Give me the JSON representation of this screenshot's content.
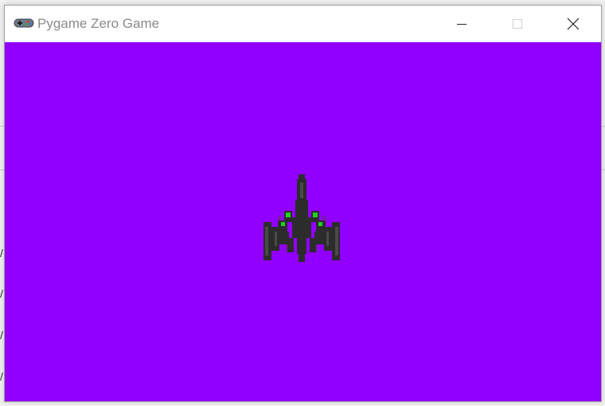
{
  "window": {
    "title": "Pygame Zero Game",
    "app_icon": "gamepad-icon",
    "controls": [
      "minimize-icon",
      "maximize-icon",
      "close-icon"
    ]
  },
  "game": {
    "background_color": "#9100ff",
    "sprite": "spaceship-icon",
    "sprite_colors": {
      "hull": "#2c2c2c",
      "highlight": "#4a4a4a",
      "engine_glow": "#7a1aa0",
      "cockpit": "#1fd11f"
    }
  },
  "background": {
    "slash_chars": [
      "/",
      "/",
      "/",
      "/"
    ]
  }
}
